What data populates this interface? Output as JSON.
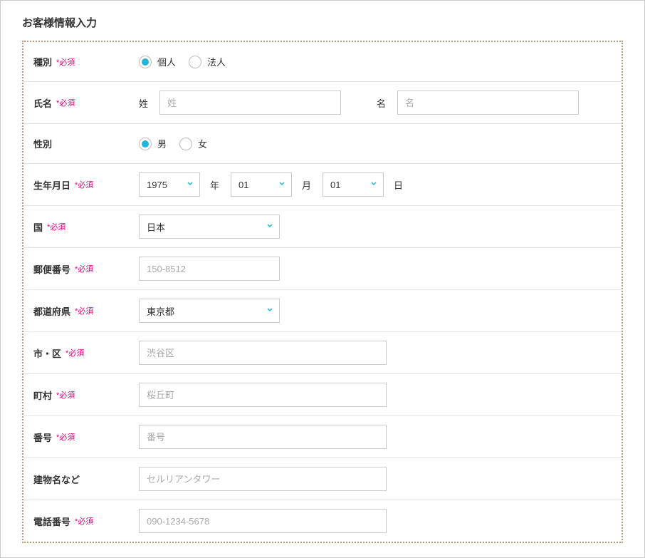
{
  "section_title": "お客様情報入力",
  "required_label": "*必須",
  "fields": {
    "type": {
      "label": "種別",
      "required": true,
      "options": [
        {
          "label": "個人",
          "checked": true
        },
        {
          "label": "法人",
          "checked": false
        }
      ]
    },
    "name": {
      "label": "氏名",
      "required": true,
      "surname": {
        "sub_label": "姓",
        "placeholder": "姓"
      },
      "given": {
        "sub_label": "名",
        "placeholder": "名"
      }
    },
    "gender": {
      "label": "性別",
      "required": false,
      "options": [
        {
          "label": "男",
          "checked": true
        },
        {
          "label": "女",
          "checked": false
        }
      ]
    },
    "birthday": {
      "label": "生年月日",
      "required": true,
      "year": {
        "value": "1975",
        "suffix": "年"
      },
      "month": {
        "value": "01",
        "suffix": "月"
      },
      "day": {
        "value": "01",
        "suffix": "日"
      }
    },
    "country": {
      "label": "国",
      "required": true,
      "value": "日本"
    },
    "postal": {
      "label": "郵便番号",
      "required": true,
      "placeholder": "150-8512"
    },
    "prefecture": {
      "label": "都道府県",
      "required": true,
      "value": "東京都"
    },
    "city": {
      "label": "市・区",
      "required": true,
      "placeholder": "渋谷区"
    },
    "town": {
      "label": "町村",
      "required": true,
      "placeholder": "桜丘町"
    },
    "number": {
      "label": "番号",
      "required": true,
      "placeholder": "番号"
    },
    "building": {
      "label": "建物名など",
      "required": false,
      "placeholder": "セルリアンタワー"
    },
    "phone": {
      "label": "電話番号",
      "required": true,
      "placeholder": "090-1234-5678"
    }
  }
}
